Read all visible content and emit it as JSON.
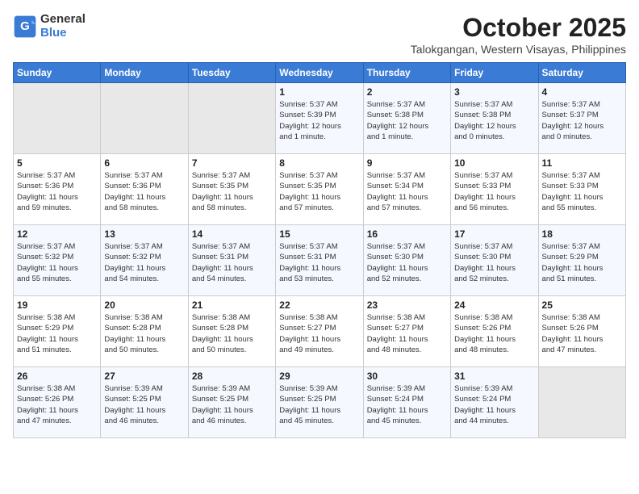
{
  "logo": {
    "general": "General",
    "blue": "Blue"
  },
  "title": "October 2025",
  "location": "Talokgangan, Western Visayas, Philippines",
  "weekdays": [
    "Sunday",
    "Monday",
    "Tuesday",
    "Wednesday",
    "Thursday",
    "Friday",
    "Saturday"
  ],
  "weeks": [
    [
      {
        "day": "",
        "info": ""
      },
      {
        "day": "",
        "info": ""
      },
      {
        "day": "",
        "info": ""
      },
      {
        "day": "1",
        "info": "Sunrise: 5:37 AM\nSunset: 5:39 PM\nDaylight: 12 hours\nand 1 minute."
      },
      {
        "day": "2",
        "info": "Sunrise: 5:37 AM\nSunset: 5:38 PM\nDaylight: 12 hours\nand 1 minute."
      },
      {
        "day": "3",
        "info": "Sunrise: 5:37 AM\nSunset: 5:38 PM\nDaylight: 12 hours\nand 0 minutes."
      },
      {
        "day": "4",
        "info": "Sunrise: 5:37 AM\nSunset: 5:37 PM\nDaylight: 12 hours\nand 0 minutes."
      }
    ],
    [
      {
        "day": "5",
        "info": "Sunrise: 5:37 AM\nSunset: 5:36 PM\nDaylight: 11 hours\nand 59 minutes."
      },
      {
        "day": "6",
        "info": "Sunrise: 5:37 AM\nSunset: 5:36 PM\nDaylight: 11 hours\nand 58 minutes."
      },
      {
        "day": "7",
        "info": "Sunrise: 5:37 AM\nSunset: 5:35 PM\nDaylight: 11 hours\nand 58 minutes."
      },
      {
        "day": "8",
        "info": "Sunrise: 5:37 AM\nSunset: 5:35 PM\nDaylight: 11 hours\nand 57 minutes."
      },
      {
        "day": "9",
        "info": "Sunrise: 5:37 AM\nSunset: 5:34 PM\nDaylight: 11 hours\nand 57 minutes."
      },
      {
        "day": "10",
        "info": "Sunrise: 5:37 AM\nSunset: 5:33 PM\nDaylight: 11 hours\nand 56 minutes."
      },
      {
        "day": "11",
        "info": "Sunrise: 5:37 AM\nSunset: 5:33 PM\nDaylight: 11 hours\nand 55 minutes."
      }
    ],
    [
      {
        "day": "12",
        "info": "Sunrise: 5:37 AM\nSunset: 5:32 PM\nDaylight: 11 hours\nand 55 minutes."
      },
      {
        "day": "13",
        "info": "Sunrise: 5:37 AM\nSunset: 5:32 PM\nDaylight: 11 hours\nand 54 minutes."
      },
      {
        "day": "14",
        "info": "Sunrise: 5:37 AM\nSunset: 5:31 PM\nDaylight: 11 hours\nand 54 minutes."
      },
      {
        "day": "15",
        "info": "Sunrise: 5:37 AM\nSunset: 5:31 PM\nDaylight: 11 hours\nand 53 minutes."
      },
      {
        "day": "16",
        "info": "Sunrise: 5:37 AM\nSunset: 5:30 PM\nDaylight: 11 hours\nand 52 minutes."
      },
      {
        "day": "17",
        "info": "Sunrise: 5:37 AM\nSunset: 5:30 PM\nDaylight: 11 hours\nand 52 minutes."
      },
      {
        "day": "18",
        "info": "Sunrise: 5:37 AM\nSunset: 5:29 PM\nDaylight: 11 hours\nand 51 minutes."
      }
    ],
    [
      {
        "day": "19",
        "info": "Sunrise: 5:38 AM\nSunset: 5:29 PM\nDaylight: 11 hours\nand 51 minutes."
      },
      {
        "day": "20",
        "info": "Sunrise: 5:38 AM\nSunset: 5:28 PM\nDaylight: 11 hours\nand 50 minutes."
      },
      {
        "day": "21",
        "info": "Sunrise: 5:38 AM\nSunset: 5:28 PM\nDaylight: 11 hours\nand 50 minutes."
      },
      {
        "day": "22",
        "info": "Sunrise: 5:38 AM\nSunset: 5:27 PM\nDaylight: 11 hours\nand 49 minutes."
      },
      {
        "day": "23",
        "info": "Sunrise: 5:38 AM\nSunset: 5:27 PM\nDaylight: 11 hours\nand 48 minutes."
      },
      {
        "day": "24",
        "info": "Sunrise: 5:38 AM\nSunset: 5:26 PM\nDaylight: 11 hours\nand 48 minutes."
      },
      {
        "day": "25",
        "info": "Sunrise: 5:38 AM\nSunset: 5:26 PM\nDaylight: 11 hours\nand 47 minutes."
      }
    ],
    [
      {
        "day": "26",
        "info": "Sunrise: 5:38 AM\nSunset: 5:26 PM\nDaylight: 11 hours\nand 47 minutes."
      },
      {
        "day": "27",
        "info": "Sunrise: 5:39 AM\nSunset: 5:25 PM\nDaylight: 11 hours\nand 46 minutes."
      },
      {
        "day": "28",
        "info": "Sunrise: 5:39 AM\nSunset: 5:25 PM\nDaylight: 11 hours\nand 46 minutes."
      },
      {
        "day": "29",
        "info": "Sunrise: 5:39 AM\nSunset: 5:25 PM\nDaylight: 11 hours\nand 45 minutes."
      },
      {
        "day": "30",
        "info": "Sunrise: 5:39 AM\nSunset: 5:24 PM\nDaylight: 11 hours\nand 45 minutes."
      },
      {
        "day": "31",
        "info": "Sunrise: 5:39 AM\nSunset: 5:24 PM\nDaylight: 11 hours\nand 44 minutes."
      },
      {
        "day": "",
        "info": ""
      }
    ]
  ]
}
